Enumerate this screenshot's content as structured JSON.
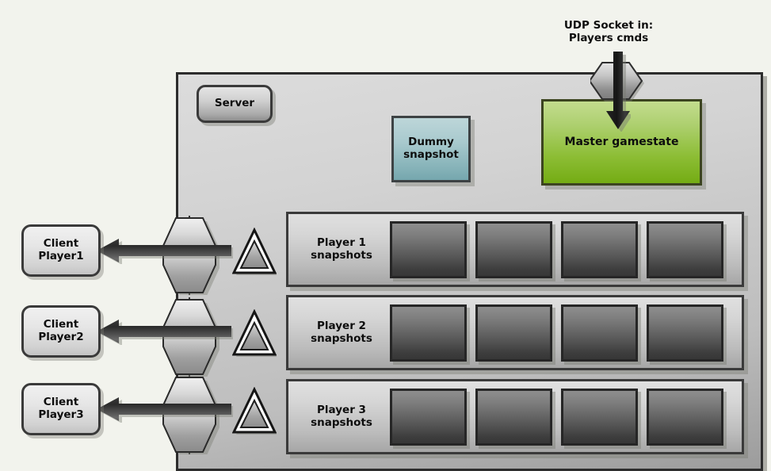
{
  "background_color": "#f2f3ed",
  "udp": {
    "caption": "UDP Socket in:\nPlayers cmds",
    "arrow_icon": "down-arrow-icon",
    "socket_icon": "socket-hexagon-icon"
  },
  "server": {
    "badge_label": "Server",
    "panel_name": "server-boundary"
  },
  "boxes": {
    "dummy_snapshot": {
      "label": "Dummy\nsnapshot",
      "color": "#a9cace"
    },
    "master_gamestate": {
      "label": "Master gamestate",
      "color": "#8cbd34"
    }
  },
  "clients": [
    {
      "label": "Client\nPlayer1",
      "arrow_icon": "left-arrow-icon",
      "socket_icon": "socket-hexagon-icon",
      "delta_icon": "delta-triangle-icon"
    },
    {
      "label": "Client\nPlayer2",
      "arrow_icon": "left-arrow-icon",
      "socket_icon": "socket-hexagon-icon",
      "delta_icon": "delta-triangle-icon"
    },
    {
      "label": "Client\nPlayer3",
      "arrow_icon": "left-arrow-icon",
      "socket_icon": "socket-hexagon-icon",
      "delta_icon": "delta-triangle-icon"
    }
  ],
  "snapshot_rows": [
    {
      "label": "Player 1\nsnapshots",
      "cell_count": 4
    },
    {
      "label": "Player 2\nsnapshots",
      "cell_count": 4
    },
    {
      "label": "Player 3\nsnapshots",
      "cell_count": 4
    }
  ]
}
